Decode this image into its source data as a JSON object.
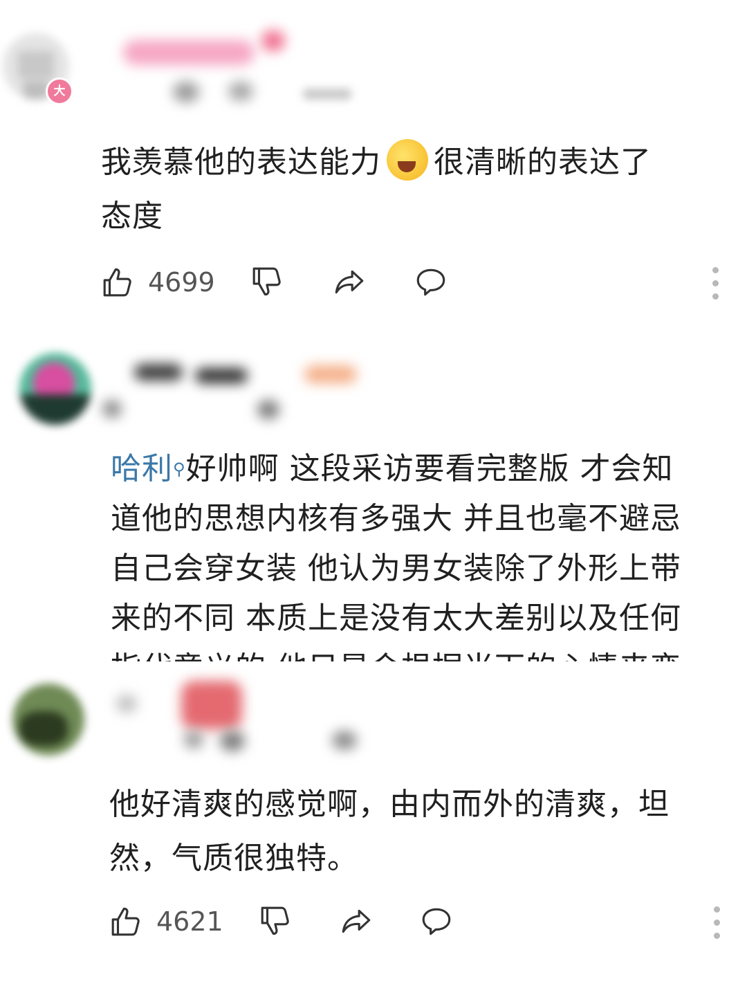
{
  "comments": [
    {
      "badge": "大",
      "text_lines": [
        "我羡慕他的表达能力",
        "很清晰的表达了",
        "态度"
      ],
      "emoji": "laughing-crying-emoji",
      "likes": "4699"
    },
    {
      "mention": "哈利",
      "text_lines": [
        "好帅啊 这段采访要看完整版 才会知",
        "道他的思想内核有多强大 并且也毫不避忌",
        "自己会穿女装 他认为男女装除了外形上带",
        "来的不同 本质上是没有太大差别以及任何",
        "指代意义的 他只是会根据当下的心情来变"
      ]
    },
    {
      "text_lines": [
        "他好清爽的感觉啊，由内而外的清爽，坦",
        "然，气质很独特。"
      ],
      "likes": "4621"
    }
  ],
  "icons": {
    "like": "thumbs-up-icon",
    "dislike": "thumbs-down-icon",
    "share": "share-arrow-icon",
    "reply": "reply-bubble-icon",
    "more": "more-vertical-icon"
  },
  "colors": {
    "mention": "#3b78a8",
    "badge": "#f07a9b",
    "icon": "#333333"
  }
}
